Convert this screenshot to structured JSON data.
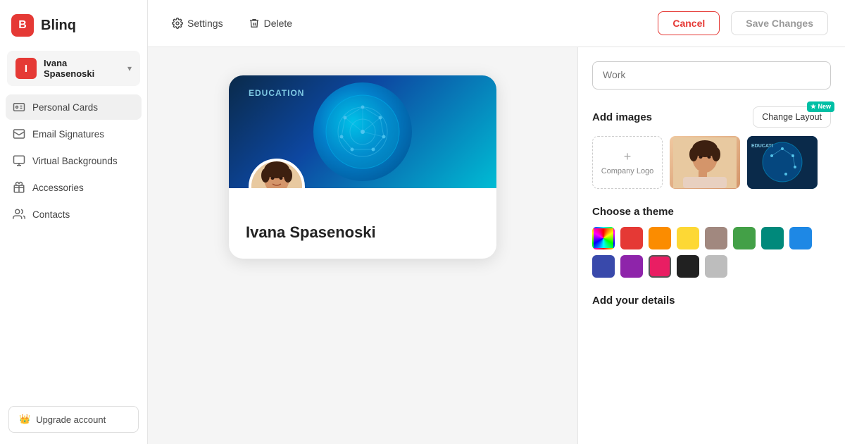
{
  "app": {
    "logo_letter": "B",
    "logo_text": "Blinq"
  },
  "user": {
    "initial": "I",
    "name": "Ivana Spasenoski"
  },
  "sidebar": {
    "items": [
      {
        "id": "personal-cards",
        "label": "Personal Cards",
        "icon": "person-card-icon"
      },
      {
        "id": "email-signatures",
        "label": "Email Signatures",
        "icon": "email-icon"
      },
      {
        "id": "virtual-backgrounds",
        "label": "Virtual Backgrounds",
        "icon": "monitor-icon"
      },
      {
        "id": "accessories",
        "label": "Accessories",
        "icon": "gift-icon"
      },
      {
        "id": "contacts",
        "label": "Contacts",
        "icon": "contacts-icon"
      }
    ],
    "upgrade_label": "Upgrade account"
  },
  "topbar": {
    "settings_label": "Settings",
    "delete_label": "Delete",
    "cancel_label": "Cancel",
    "save_label": "Save Changes"
  },
  "card_preview": {
    "education_label": "EDUCATION",
    "person_name": "Ivana Spasenoski"
  },
  "right_panel": {
    "work_placeholder": "Work",
    "add_images_title": "Add images",
    "change_layout_label": "Change Layout",
    "new_badge_label": "★ New",
    "company_logo_label": "+ Company Logo",
    "choose_theme_title": "Choose a theme",
    "add_details_title": "Add your details",
    "theme_colors": [
      {
        "id": "rainbow",
        "color": "rainbow",
        "active": false
      },
      {
        "id": "red",
        "color": "#e53935",
        "active": false
      },
      {
        "id": "orange",
        "color": "#fb8c00",
        "active": false
      },
      {
        "id": "yellow",
        "color": "#fdd835",
        "active": false
      },
      {
        "id": "tan",
        "color": "#a1887f",
        "active": false
      },
      {
        "id": "green",
        "color": "#43a047",
        "active": false
      },
      {
        "id": "teal",
        "color": "#00897b",
        "active": false
      },
      {
        "id": "blue",
        "color": "#1e88e5",
        "active": false
      },
      {
        "id": "indigo",
        "color": "#3949ab",
        "active": false
      },
      {
        "id": "purple",
        "color": "#8e24aa",
        "active": false
      },
      {
        "id": "pink",
        "color": "#e91e63",
        "active": true
      },
      {
        "id": "black",
        "color": "#212121",
        "active": false
      },
      {
        "id": "gray",
        "color": "#bdbdbd",
        "active": false
      }
    ]
  }
}
